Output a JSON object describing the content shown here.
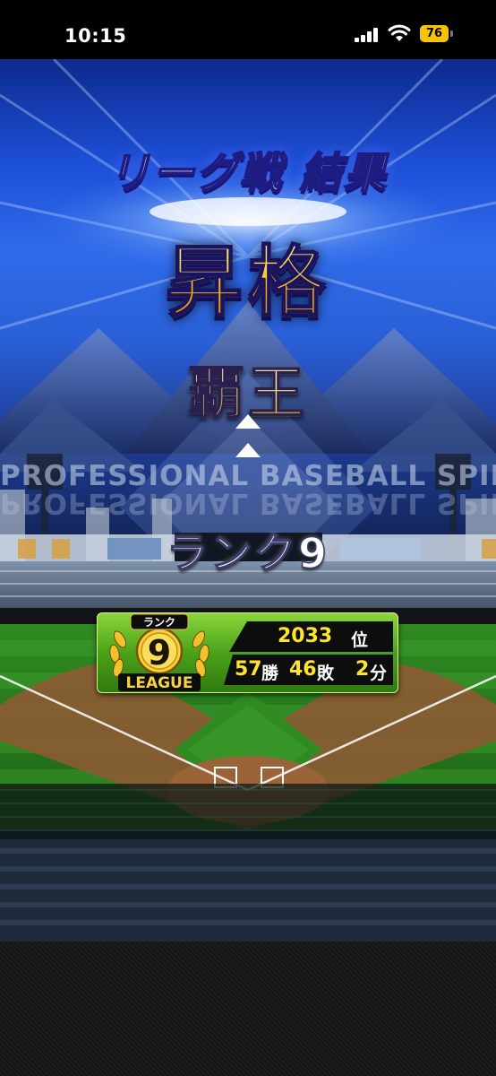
{
  "status_bar": {
    "time": "10:15",
    "battery": "76"
  },
  "screen": {
    "league_title": "リーグ戦 結果",
    "result": "昇格",
    "rank_name": "覇王",
    "watermark": "PROFESSIONAL BASEBALL SPIRITS A",
    "rank_number": "ランク9"
  },
  "result_panel": {
    "badge_rank_label": "ランク",
    "badge_rank_number": "9",
    "badge_league_label": "LEAGUE",
    "position": "2033",
    "position_unit": "位",
    "wins": "57",
    "wins_unit": "勝",
    "losses": "46",
    "losses_unit": "敗",
    "draws": "2",
    "draws_unit": "分"
  },
  "colors": {
    "accent_gold": "#ffd43b",
    "sky_blue": "#2f6bea",
    "panel_green": "#4ba219",
    "value_yellow": "#ffe52a"
  }
}
